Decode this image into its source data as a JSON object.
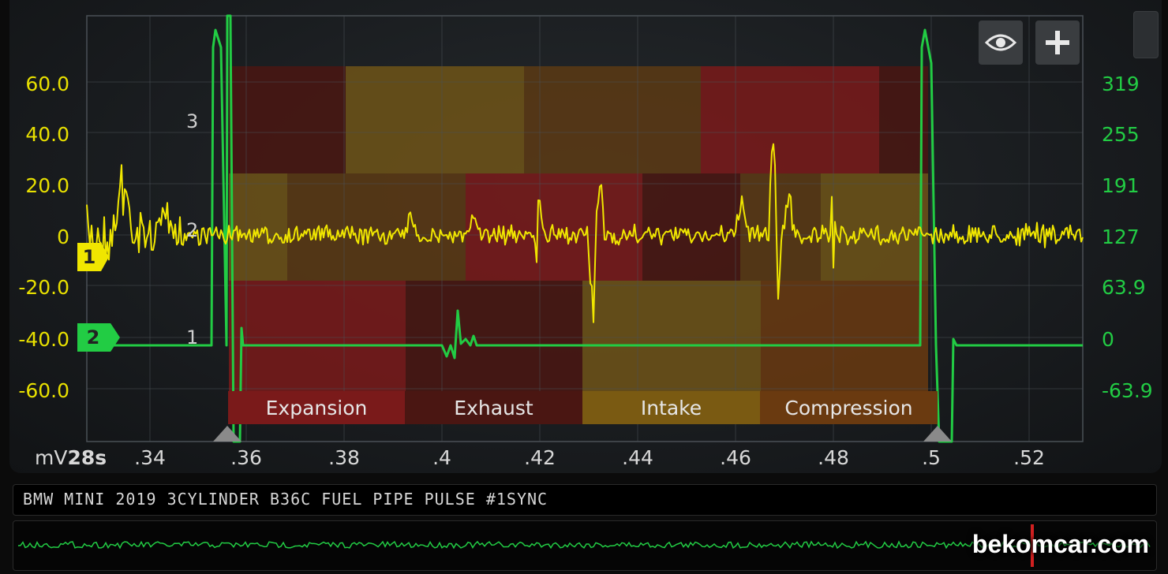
{
  "scope": {
    "colors": {
      "channel1": "#f0e600",
      "channel2": "#22cc44",
      "grid": "#4a5056",
      "phase_expansion": "#7a1a1a",
      "phase_exhaust": "#4a1612",
      "phase_intake": "#7a5a12",
      "phase_compression": "#6a3a10"
    },
    "left_axis": {
      "ticks": [
        "60.0",
        "40.0",
        "20.0",
        "0",
        "-20.0",
        "-40.0",
        "-60.0"
      ]
    },
    "right_axis": {
      "ticks": [
        "319",
        "255",
        "191",
        "127",
        "63.9",
        "0",
        "-63.9"
      ]
    },
    "x_axis": {
      "unit": "mV",
      "timebase": "28s",
      "ticks": [
        ".34",
        ".36",
        ".38",
        ".4",
        ".42",
        ".44",
        ".46",
        ".48",
        ".5",
        ".52"
      ]
    },
    "cylinder_counts": [
      "3",
      "2",
      "1"
    ],
    "channel_markers": [
      {
        "label": "1",
        "icon": "channel-1-marker-icon"
      },
      {
        "label": "2",
        "icon": "channel-2-marker-icon"
      }
    ],
    "phases": [
      "Expansion",
      "Exhaust",
      "Intake",
      "Compression"
    ],
    "toolbar": {
      "view_icon": "eye-icon",
      "add_icon": "plus-icon"
    }
  },
  "title": "BMW MINI 2019 3CYLINDER B36C FUEL PIPE PULSE #1SYNC",
  "watermark": "bekomcar.com"
}
